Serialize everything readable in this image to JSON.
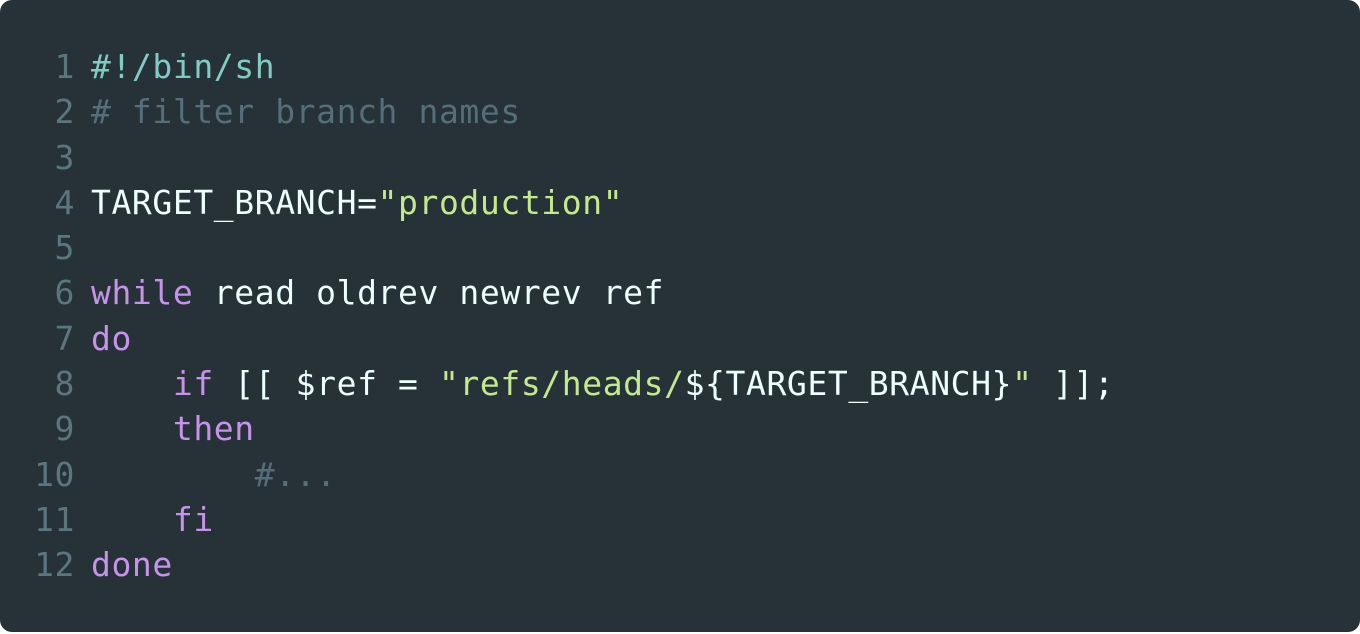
{
  "editor": {
    "colors": {
      "background": "#263238",
      "line_number": "#5c7680",
      "plain": "#eeffff",
      "keyword": "#c792ea",
      "string": "#c3e88d",
      "comment": "#546e7a",
      "shebang": "#80cbc4"
    },
    "lines": [
      {
        "number": "1",
        "tokens": [
          {
            "text": "#!/bin/sh",
            "type": "shebang"
          }
        ]
      },
      {
        "number": "2",
        "tokens": [
          {
            "text": "# filter branch names",
            "type": "comment"
          }
        ]
      },
      {
        "number": "3",
        "tokens": []
      },
      {
        "number": "4",
        "tokens": [
          {
            "text": "TARGET_BRANCH=",
            "type": "plain"
          },
          {
            "text": "\"production\"",
            "type": "string"
          }
        ]
      },
      {
        "number": "5",
        "tokens": []
      },
      {
        "number": "6",
        "tokens": [
          {
            "text": "while",
            "type": "keyword"
          },
          {
            "text": " read oldrev newrev ref",
            "type": "plain"
          }
        ]
      },
      {
        "number": "7",
        "tokens": [
          {
            "text": "do",
            "type": "keyword"
          }
        ]
      },
      {
        "number": "8",
        "tokens": [
          {
            "text": "    ",
            "type": "plain"
          },
          {
            "text": "if",
            "type": "keyword"
          },
          {
            "text": " [[ $ref = ",
            "type": "plain"
          },
          {
            "text": "\"refs/heads/",
            "type": "string"
          },
          {
            "text": "${TARGET_BRANCH}",
            "type": "plain"
          },
          {
            "text": "\"",
            "type": "string"
          },
          {
            "text": " ]];",
            "type": "plain"
          }
        ]
      },
      {
        "number": "9",
        "tokens": [
          {
            "text": "    ",
            "type": "plain"
          },
          {
            "text": "then",
            "type": "keyword"
          }
        ]
      },
      {
        "number": "10",
        "tokens": [
          {
            "text": "        ",
            "type": "plain"
          },
          {
            "text": "#...",
            "type": "comment"
          }
        ]
      },
      {
        "number": "11",
        "tokens": [
          {
            "text": "    ",
            "type": "plain"
          },
          {
            "text": "fi",
            "type": "keyword"
          }
        ]
      },
      {
        "number": "12",
        "tokens": [
          {
            "text": "done",
            "type": "keyword"
          }
        ]
      }
    ]
  }
}
